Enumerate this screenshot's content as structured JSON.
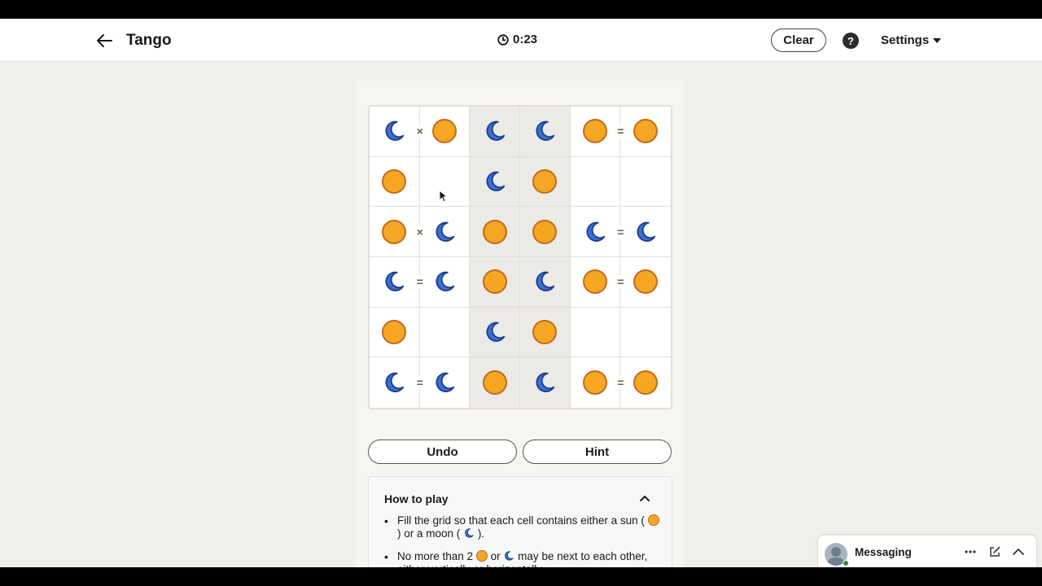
{
  "header": {
    "title": "Tango",
    "timer": "0:23",
    "clear_label": "Clear",
    "help_label": "?",
    "settings_label": "Settings"
  },
  "grid": {
    "rows": 6,
    "cols": 6,
    "cells": [
      [
        "moon",
        "sun",
        "moon",
        "moon",
        "sun",
        "sun"
      ],
      [
        "sun",
        "",
        "moon",
        "sun",
        "",
        ""
      ],
      [
        "sun",
        "moon",
        "sun",
        "sun",
        "moon",
        "moon"
      ],
      [
        "moon",
        "moon",
        "sun",
        "moon",
        "sun",
        "sun"
      ],
      [
        "sun",
        "",
        "moon",
        "sun",
        "",
        ""
      ],
      [
        "moon",
        "moon",
        "sun",
        "moon",
        "sun",
        "sun"
      ]
    ],
    "locked_cols": [
      2,
      3
    ],
    "constraints": [
      {
        "row": 0,
        "col": 0,
        "dir": "h",
        "symbol": "×"
      },
      {
        "row": 0,
        "col": 4,
        "dir": "h",
        "symbol": "="
      },
      {
        "row": 2,
        "col": 0,
        "dir": "h",
        "symbol": "×"
      },
      {
        "row": 2,
        "col": 4,
        "dir": "h",
        "symbol": "="
      },
      {
        "row": 3,
        "col": 0,
        "dir": "h",
        "symbol": "="
      },
      {
        "row": 3,
        "col": 4,
        "dir": "h",
        "symbol": "="
      },
      {
        "row": 5,
        "col": 0,
        "dir": "h",
        "symbol": "="
      },
      {
        "row": 5,
        "col": 4,
        "dir": "h",
        "symbol": "="
      }
    ]
  },
  "controls": {
    "undo_label": "Undo",
    "hint_label": "Hint"
  },
  "how_to_play": {
    "title": "How to play",
    "rule1_a": "Fill the grid so that each cell contains either a sun (",
    "rule1_b": ") or a moon (",
    "rule1_c": ").",
    "rule2_a": "No more than 2",
    "rule2_b": "or",
    "rule2_c": "may be next to each other, either vertically or horizontally."
  },
  "messaging": {
    "label": "Messaging"
  },
  "colors": {
    "sun_fill": "#f5a623",
    "sun_stroke": "#c46a1a",
    "moon_fill": "#3b6fd1",
    "moon_stroke": "#1d3f8f"
  }
}
